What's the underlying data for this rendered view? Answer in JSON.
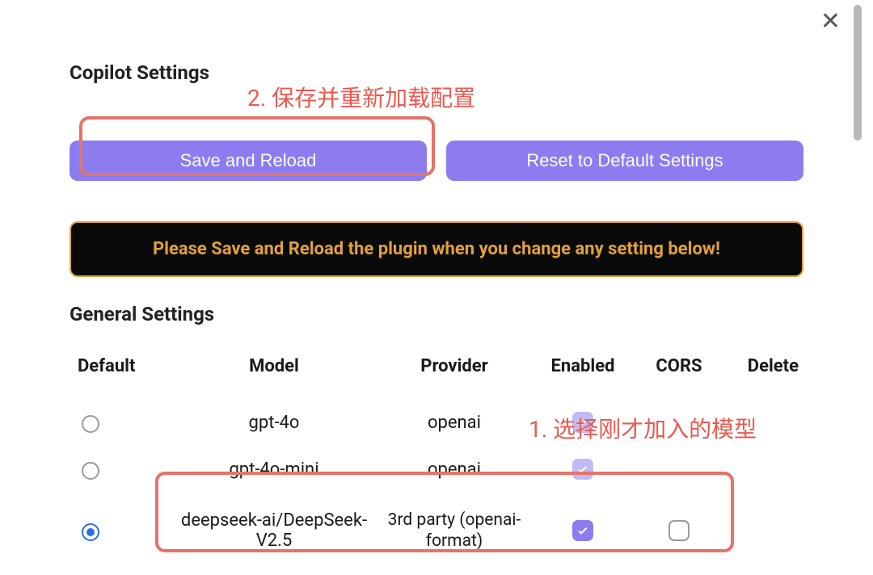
{
  "close_glyph": "✕",
  "headings": {
    "copilot": "Copilot Settings",
    "general": "General Settings"
  },
  "buttons": {
    "save": "Save and Reload",
    "reset": "Reset to Default Settings"
  },
  "warning_text": "Please Save and Reload the plugin when you change any setting below!",
  "annotations": {
    "step2": "2. 保存并重新加载配置",
    "step1": "1. 选择刚才加入的模型"
  },
  "columns": {
    "default": "Default",
    "model": "Model",
    "provider": "Provider",
    "enabled": "Enabled",
    "cors": "CORS",
    "delete": "Delete"
  },
  "rows": [
    {
      "default": false,
      "model": "gpt-4o",
      "provider": "openai",
      "enabled": true,
      "enabled_faded": true,
      "cors": null,
      "delete": null
    },
    {
      "default": false,
      "model": "gpt-4o-mini",
      "provider": "openai",
      "enabled": true,
      "enabled_faded": true,
      "cors": null,
      "delete": null
    },
    {
      "default": true,
      "model": "deepseek-ai/DeepSeek-V2.5",
      "provider": "3rd party (openai-format)",
      "enabled": true,
      "enabled_faded": false,
      "cors": false,
      "delete": null
    }
  ],
  "colors": {
    "accent": "#8c7cf0",
    "annotation": "#e57368",
    "warning_fg": "#e2a13a"
  }
}
